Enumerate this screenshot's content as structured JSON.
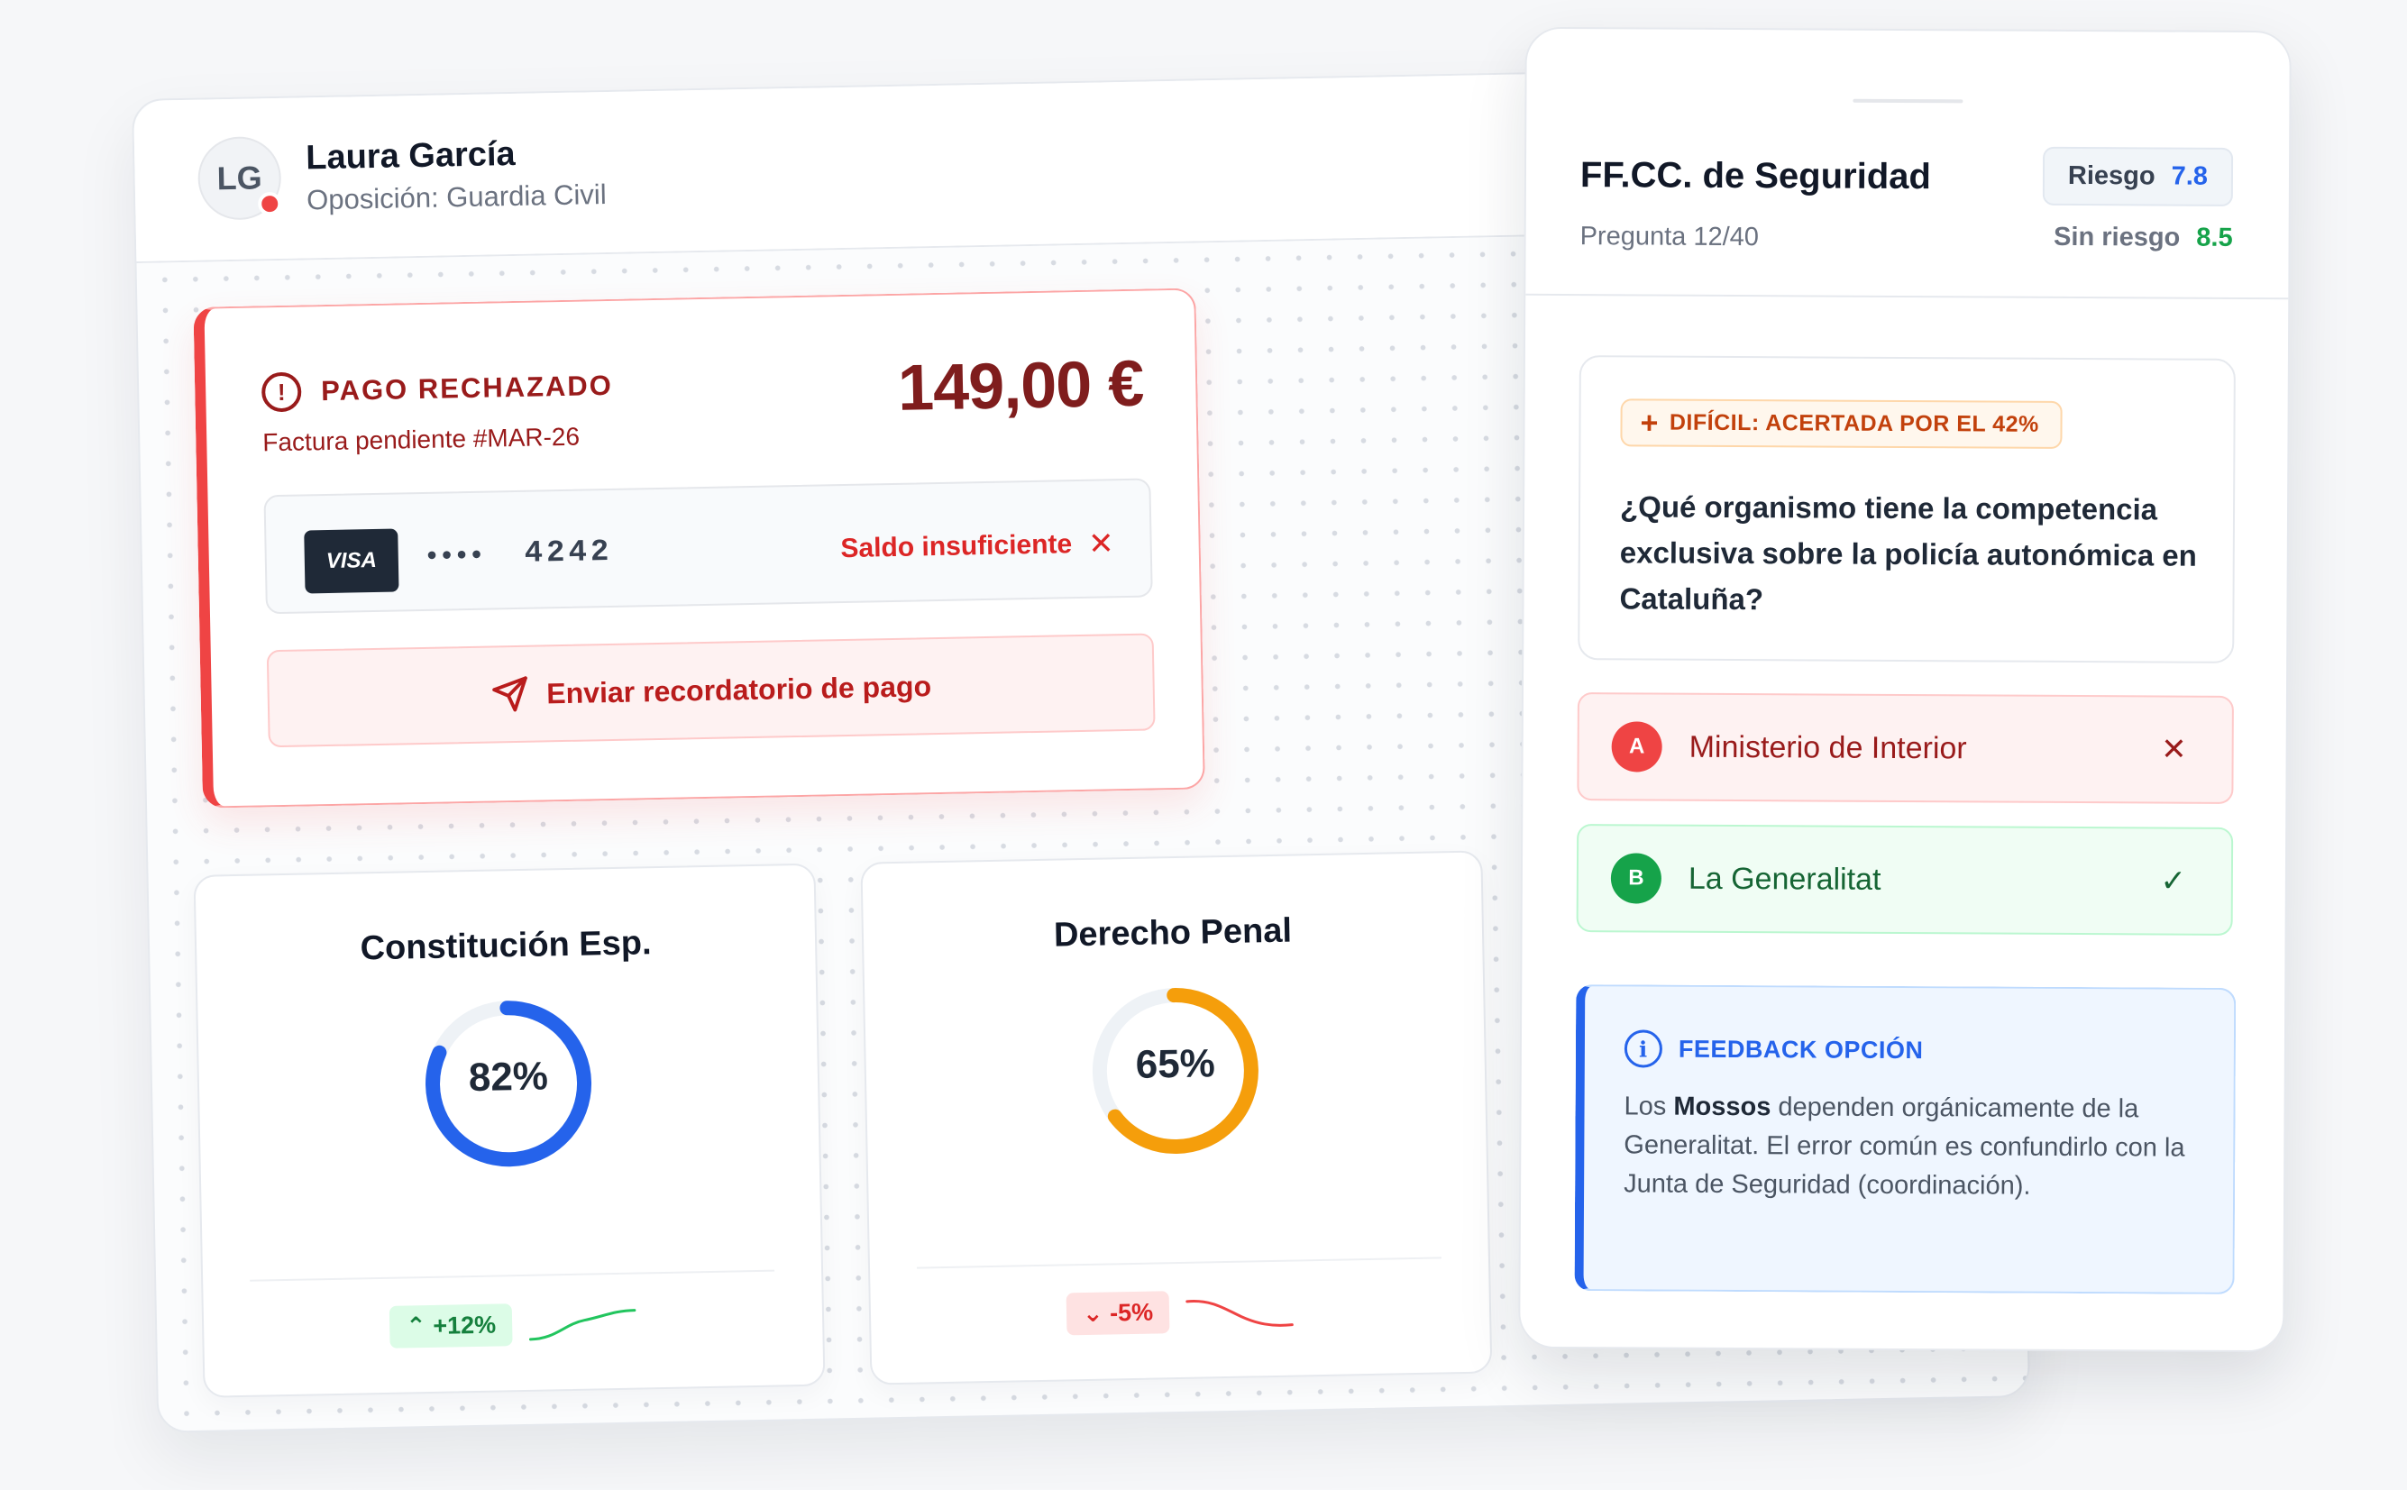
{
  "profile": {
    "initials": "LG",
    "name": "Laura García",
    "subtitle": "Oposición: Guardia Civil"
  },
  "payment": {
    "status": "PAGO RECHAZADO",
    "invoice": "Factura pendiente #MAR-26",
    "amount": "149,00 €",
    "card_brand": "VISA",
    "card_mask": "••••",
    "card_last4": "4242",
    "error": "Saldo insuficiente",
    "reminder_button": "Enviar recordatorio de pago"
  },
  "stats": [
    {
      "title": "Constitución Esp.",
      "percent_label": "82%",
      "percent": 82,
      "trend": "+12%",
      "trend_dir": "up",
      "color": "#2563eb"
    },
    {
      "title": "Derecho Penal",
      "percent_label": "65%",
      "percent": 65,
      "trend": "-5%",
      "trend_dir": "down",
      "color": "#f59e0b"
    }
  ],
  "quiz": {
    "title": "FF.CC. de Seguridad",
    "progress": "Pregunta 12/40",
    "risk_label": "Riesgo",
    "risk_value": "7.8",
    "norisk_label": "Sin riesgo",
    "norisk_value": "8.5",
    "difficulty": "DIFÍCIL: ACERTADA POR EL 42%",
    "question": "¿Qué organismo tiene la competencia exclusiva sobre la policía autonómica en Cataluña?",
    "options": [
      {
        "letter": "A",
        "label": "Ministerio de Interior",
        "state": "wrong"
      },
      {
        "letter": "B",
        "label": "La Generalitat",
        "state": "correct"
      }
    ],
    "feedback_title": "FEEDBACK OPCIÓN",
    "feedback_pre": "Los ",
    "feedback_bold": "Mossos",
    "feedback_post": " dependen orgánicamente de la Generalitat. El error común es confundirlo con la Junta de Seguridad (coordinación)."
  },
  "colors": {
    "danger": "#ef4444",
    "success": "#16a34a",
    "accent": "#2563eb",
    "warning": "#f59e0b"
  }
}
